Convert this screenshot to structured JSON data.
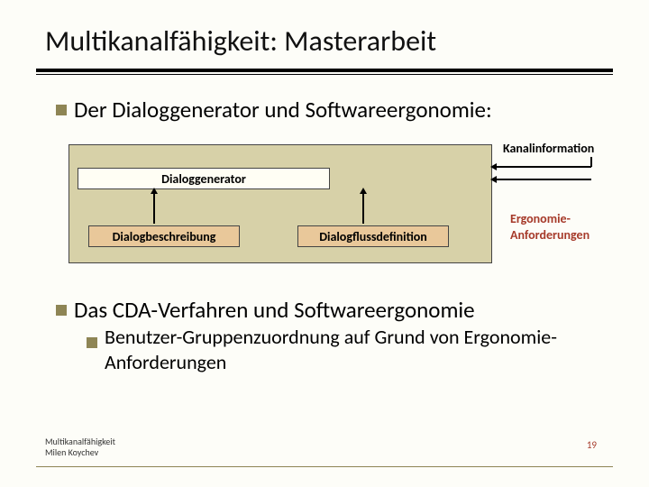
{
  "title": "Multikanalfähigkeit: Masterarbeit",
  "bullets": {
    "b1": "Der Dialoggenerator und Softwareergonomie:",
    "b2": "Das CDA-Verfahren und Softwareergonomie",
    "b3": "Benutzer-Gruppenzuordnung auf Grund von Ergonomie-Anforderungen"
  },
  "diagram": {
    "generator": "Dialoggenerator",
    "desc": "Dialogbeschreibung",
    "flow": "Dialogflussdefinition",
    "kanal": "Kanalinformation",
    "erg1": "Ergonomie-",
    "erg2": "Anforderungen"
  },
  "footer": {
    "line1": "Multikanalfähigkeit",
    "line2": "Milen Koychev",
    "page": "19"
  }
}
